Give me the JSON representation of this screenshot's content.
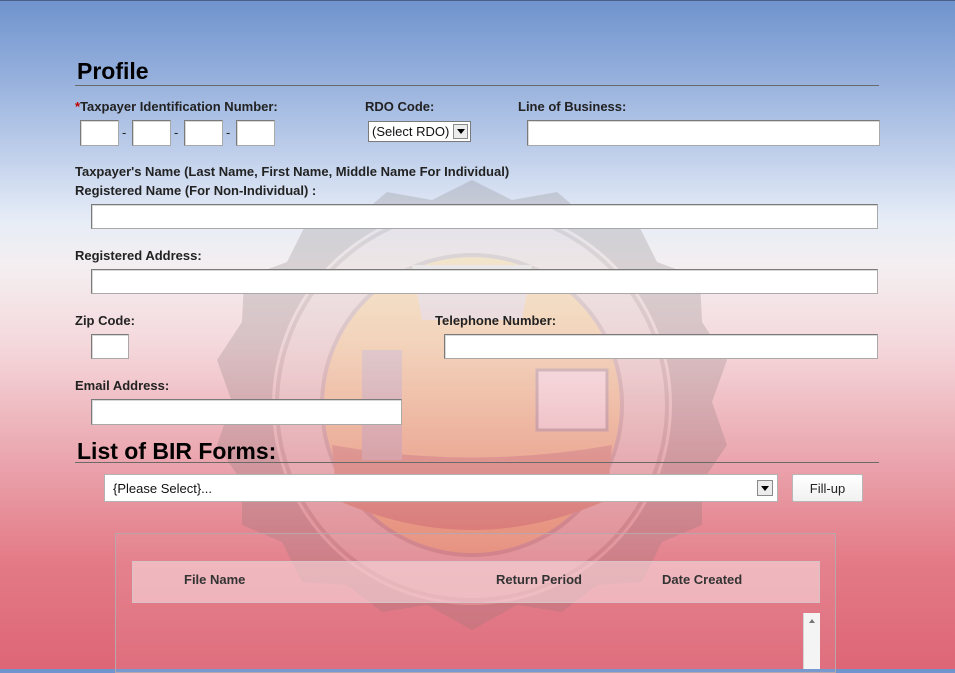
{
  "profile": {
    "title": "Profile",
    "tin": {
      "required_mark": "*",
      "label": "Taxpayer Identification Number:",
      "separator": "-"
    },
    "rdo": {
      "label": "RDO Code:",
      "selected": "(Select RDO)"
    },
    "line_of_business": {
      "label": "Line of Business:"
    },
    "taxpayer_name": {
      "label_line1": "Taxpayer's Name (Last Name, First Name, Middle Name For Individual)",
      "label_line2": "Registered Name (For Non-Individual) :"
    },
    "registered_address": {
      "label": "Registered Address:"
    },
    "zip_code": {
      "label": "Zip Code:"
    },
    "telephone": {
      "label": "Telephone Number:"
    },
    "email": {
      "label": "Email Address:"
    }
  },
  "forms": {
    "title": "List of BIR Forms:",
    "selected": "{Please Select}...",
    "fillup_label": "Fill-up",
    "table": {
      "columns": [
        "File Name",
        "Return Period",
        "Date Created"
      ]
    }
  },
  "colors": {
    "background_top": "#6f93cd",
    "background_bottom": "#de6676",
    "required": "#c00000"
  },
  "icons": {
    "select_arrow": "chevron-down-icon",
    "scroll_up": "scroll-up-arrow-icon",
    "watermark": "bir-seal-icon"
  }
}
